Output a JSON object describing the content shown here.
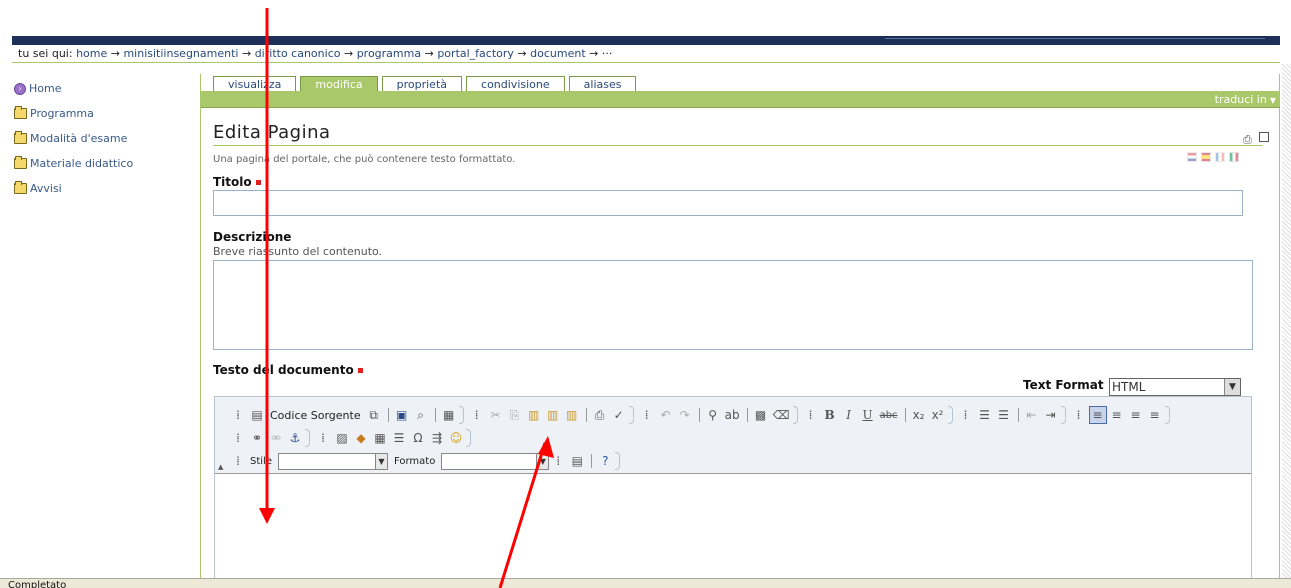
{
  "breadcrumb": {
    "prefix": "tu sei qui:",
    "items": [
      "home",
      "minisitiinsegnamenti",
      "diritto canonico",
      "programma",
      "portal_factory",
      "document",
      "···"
    ],
    "separator": "→"
  },
  "sidebar": {
    "items": [
      {
        "label": "Home",
        "icon": "home-icon"
      },
      {
        "label": "Programma",
        "icon": "folder-icon"
      },
      {
        "label": "Modalità d'esame",
        "icon": "folder-icon"
      },
      {
        "label": "Materiale didattico",
        "icon": "folder-icon"
      },
      {
        "label": "Avvisi",
        "icon": "folder-icon"
      }
    ]
  },
  "tabs": [
    {
      "label": "visualizza",
      "active": false
    },
    {
      "label": "modifica",
      "active": true
    },
    {
      "label": "proprietà",
      "active": false
    },
    {
      "label": "condivisione",
      "active": false
    },
    {
      "label": "aliases",
      "active": false
    }
  ],
  "traduci": "traduci in",
  "page": {
    "title": "Edita Pagina",
    "subtitle": "Una pagina del portale, che può contenere testo formattato."
  },
  "fields": {
    "titolo_label": "Titolo",
    "titolo_value": "",
    "descrizione_label": "Descrizione",
    "descrizione_help": "Breve riassunto del contenuto.",
    "descrizione_value": "",
    "testo_label": "Testo del documento"
  },
  "text_format": {
    "label": "Text Format",
    "value": "HTML"
  },
  "editor": {
    "source_label": "Codice Sorgente",
    "style_label": "Stile",
    "format_label": "Formato"
  },
  "statusbar": {
    "text": "Completato"
  },
  "colors": {
    "accent_green": "#a8c86a",
    "header_navy": "#1e2f5a",
    "required_red": "#e02020",
    "annotation_arrow": "#ff0000"
  }
}
